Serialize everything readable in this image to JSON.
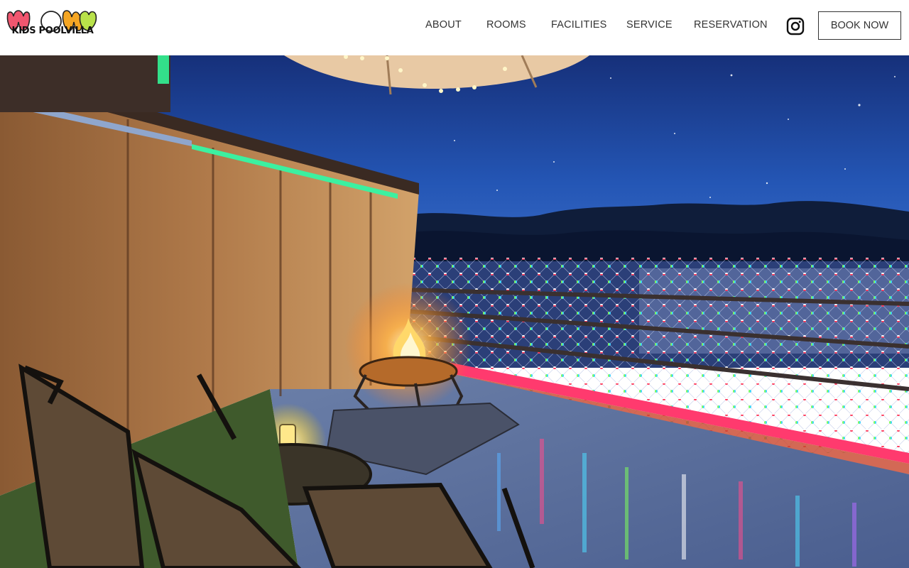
{
  "brand": {
    "logo_text": "KIDS POOLVILLA",
    "logo_colors": [
      "#f0566f",
      "#ffffff",
      "#f5a623",
      "#b9e24a"
    ]
  },
  "nav": {
    "items": [
      {
        "label": "ABOUT"
      },
      {
        "label": "ROOMS"
      },
      {
        "label": "FACILITIES"
      },
      {
        "label": "SERVICE"
      },
      {
        "label": "RESERVATION"
      }
    ],
    "instagram_icon": "instagram-icon",
    "book_label": "BOOK NOW"
  },
  "colors": {
    "header_bg": "#ffffff",
    "nav_text": "#333333",
    "sky": "#1f3f8f",
    "mountains": "#0d1a33"
  }
}
